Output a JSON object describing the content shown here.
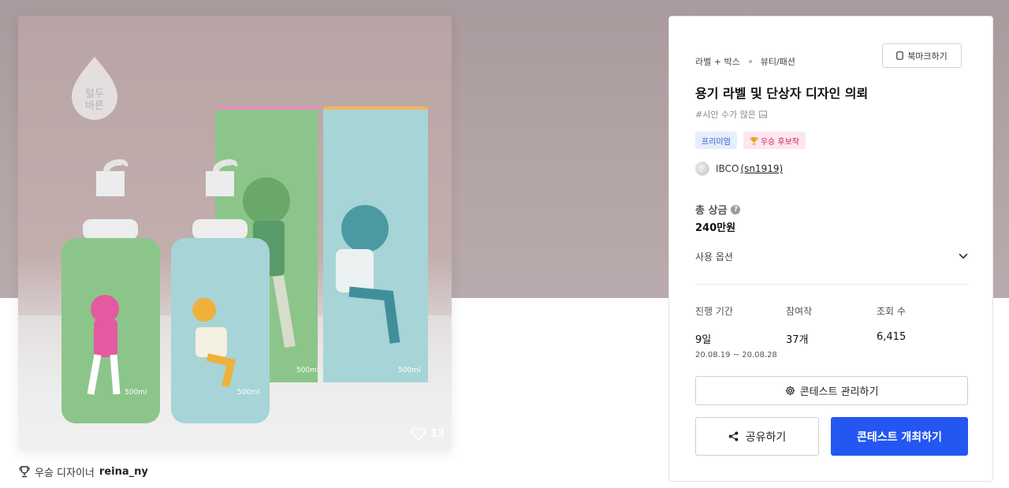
{
  "colors": {
    "primary": "#2456F2",
    "hero_background": "#B3A4A6",
    "premium_badge_text": "#2B58CC",
    "winner_badge_text": "#C8265A"
  },
  "image": {
    "logo_line1": "털두",
    "logo_line2": "바른",
    "like_icon": "heart-outline-icon",
    "like_count": "13"
  },
  "winner_line": {
    "icon": "trophy-icon",
    "label": "우승 디자이너",
    "designer": "reina_ny"
  },
  "panel": {
    "breadcrumb": [
      "라벨 + 박스",
      "뷰티/패션"
    ],
    "bookmark_label": "북마크하기",
    "title": "용기 라벨 및 단상자 디자인 의뢰",
    "subtitle": "#시안 수가 많은",
    "badges": {
      "premium": "프리미엄",
      "winner": "우승 후보작"
    },
    "owner": {
      "name": "IBCO",
      "id": "(sn1919)"
    },
    "prize": {
      "label": "총 상금",
      "value": "240만원"
    },
    "usage_option_label": "사용 옵션",
    "stats": {
      "duration": {
        "label": "진행 기간",
        "value": "9일",
        "dates": "20.08.19 ~ 20.08.28"
      },
      "participants": {
        "label": "참여작",
        "value": "37개"
      },
      "views": {
        "label": "조회 수",
        "value": "6,415"
      }
    },
    "manage_button": "콘테스트 관리하기",
    "share_button": "공유하기",
    "host_button": "콘테스트 개최하기"
  }
}
